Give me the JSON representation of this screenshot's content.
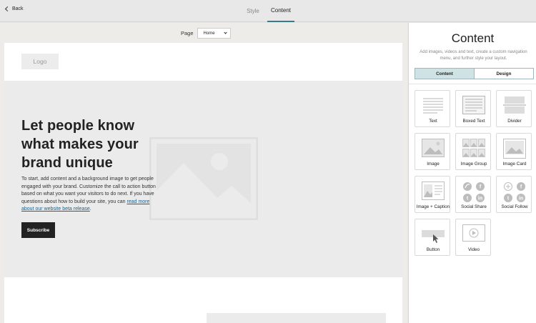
{
  "topbar": {
    "back_label": "Back",
    "tabs": [
      {
        "label": "Style",
        "active": false
      },
      {
        "label": "Content",
        "active": true
      }
    ]
  },
  "editor": {
    "page_label": "Page",
    "page_select_value": "Home",
    "logo_text": "Logo",
    "hero": {
      "headline": "Let people know what makes your brand unique",
      "body": "To start, add content and a background image to get people engaged with your brand. Customize the call to action button based on what you want your visitors to do next. If you have questions about how to build your site, you can ",
      "link_text": "read more about our website beta release",
      "link_suffix": ".",
      "button_label": "Subscribe"
    }
  },
  "panel": {
    "title": "Content",
    "description": "Add images, videos and text, create a custom navigation menu, and further style your layout.",
    "segments": [
      {
        "label": "Content",
        "active": true
      },
      {
        "label": "Design",
        "active": false
      }
    ],
    "blocks": [
      {
        "label": "Text",
        "icon": "text-icon"
      },
      {
        "label": "Boxed Text",
        "icon": "boxed-text-icon"
      },
      {
        "label": "Divider",
        "icon": "divider-icon"
      },
      {
        "label": "Image",
        "icon": "image-icon"
      },
      {
        "label": "Image Group",
        "icon": "image-group-icon"
      },
      {
        "label": "Image Card",
        "icon": "image-card-icon"
      },
      {
        "label": "Image + Caption",
        "icon": "image-caption-icon"
      },
      {
        "label": "Social Share",
        "icon": "social-share-icon"
      },
      {
        "label": "Social Follow",
        "icon": "social-follow-icon"
      },
      {
        "label": "Button",
        "icon": "button-icon"
      },
      {
        "label": "Video",
        "icon": "video-icon"
      }
    ]
  },
  "colors": {
    "accent": "#3a7b87",
    "segment_active": "#cfe3e4",
    "link": "#1f5f86",
    "button_dark": "#222222"
  }
}
